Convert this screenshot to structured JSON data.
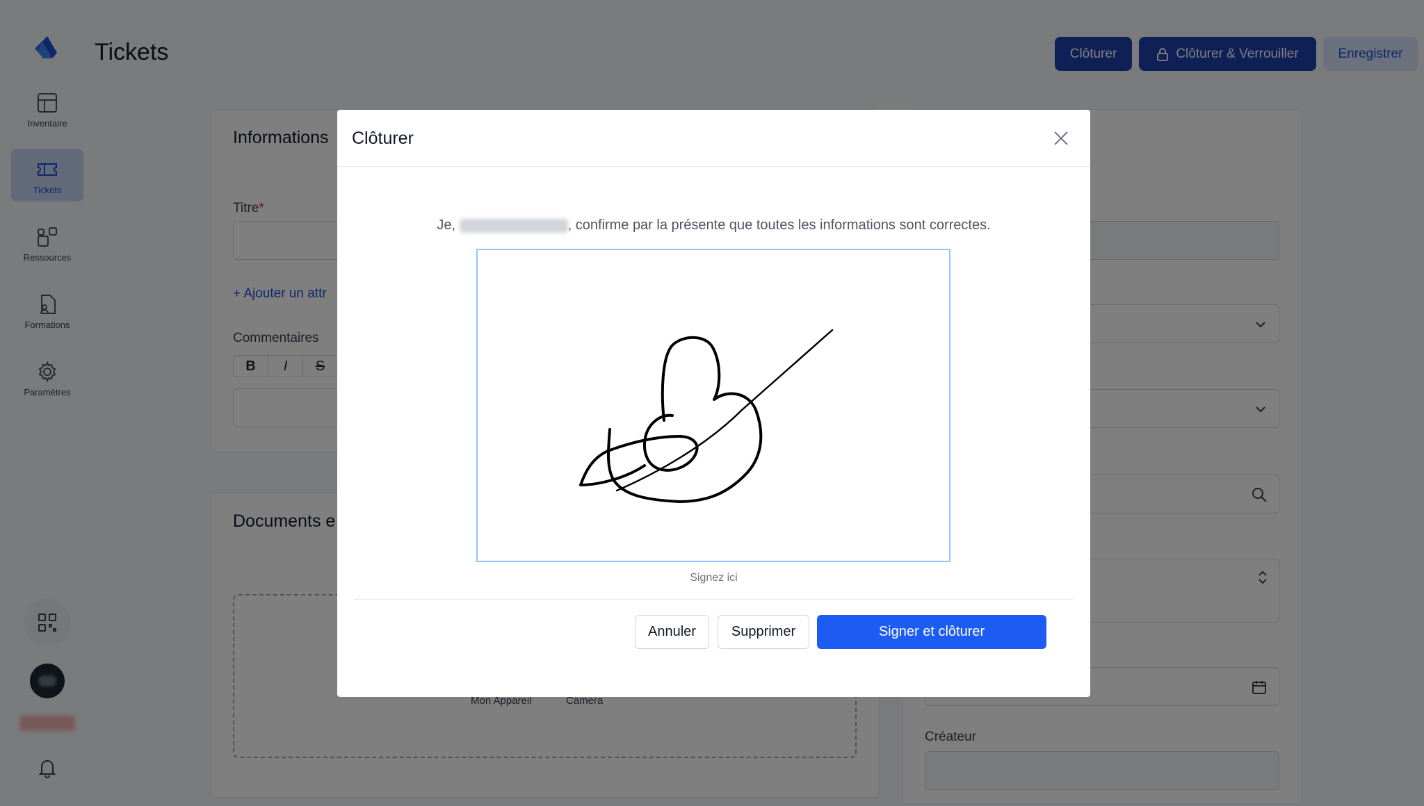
{
  "header": {
    "title": "Tickets",
    "btn_close": "Clôturer",
    "btn_close_lock": "Clôturer & Verrouiller",
    "btn_save": "Enregistrer"
  },
  "sidebar": {
    "items": [
      {
        "label": "Inventaire",
        "icon": "grid-icon"
      },
      {
        "label": "Tickets",
        "icon": "ticket-icon",
        "active": true
      },
      {
        "label": "Ressources",
        "icon": "resources-icon"
      },
      {
        "label": "Formations",
        "icon": "document-user-icon"
      },
      {
        "label": "Paramètres",
        "icon": "gear-icon"
      }
    ]
  },
  "form": {
    "section_info": "Informations",
    "title_label": "Titre",
    "required_mark": "*",
    "add_attr": "+ Ajouter un attr",
    "comments_label": "Commentaires",
    "toolbar": {
      "bold": "B",
      "italic": "I",
      "strike": "S"
    },
    "section_docs": "Documents e",
    "upload_device": "Mon Appareil",
    "upload_camera": "Camera",
    "creator_label": "Créateur"
  },
  "modal": {
    "title": "Clôturer",
    "confirm_prefix": "Je,",
    "confirm_suffix": ", confirme par la présente que toutes les informations sont correctes.",
    "sign_hint": "Signez ici",
    "btn_cancel": "Annuler",
    "btn_delete": "Supprimer",
    "btn_sign": "Signer et clôturer"
  },
  "colors": {
    "primary": "#1e40af",
    "accent": "#1d5cf2",
    "overlay": "rgba(0,0,0,0.5)"
  }
}
